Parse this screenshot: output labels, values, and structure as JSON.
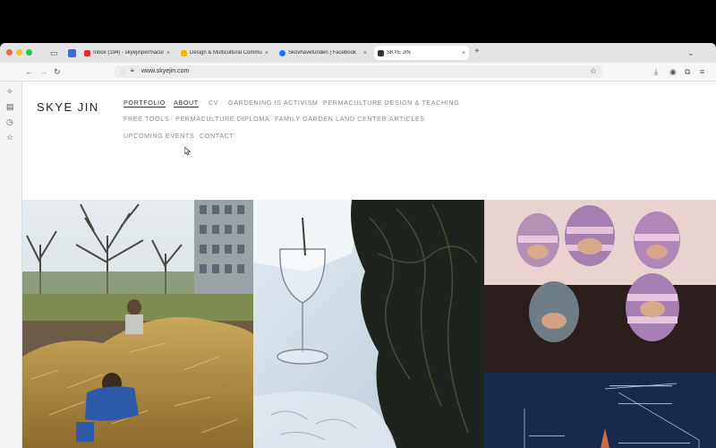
{
  "browser": {
    "tabs": [
      {
        "label": "Inbox (194) - skyejinpermacult...",
        "favicon_color": "#d93025"
      },
      {
        "label": "Design & Multicultural Commun...",
        "favicon_color": "#f4b400"
      },
      {
        "label": "Skovhavefunden | Facebook",
        "favicon_color": "#1877f2"
      },
      {
        "label": "SKYE JIN",
        "favicon_color": "#333333"
      }
    ],
    "new_tab": "+",
    "url": "www.skyejin.com"
  },
  "site": {
    "title": "SKYE JIN",
    "nav": [
      "PORTFOLIO",
      "ABOUT",
      "CV",
      "GARDENING IS ACTIVISM",
      "PERMACULTURE DESIGN & TEACHING",
      "FREE TOOLS",
      "PERMACULTURE DIPLOMA",
      "FAMILY GARDEN LAND CENTER",
      "ARTICLES",
      "UPCOMING EVENTS",
      "CONTACT"
    ]
  },
  "gallery": [
    {
      "subject": "children-in-hay-garden"
    },
    {
      "subject": "wine-glass-on-snow"
    },
    {
      "subject": "knit-balaclava-portraits"
    },
    {
      "subject": "dark-blue-poster"
    }
  ]
}
